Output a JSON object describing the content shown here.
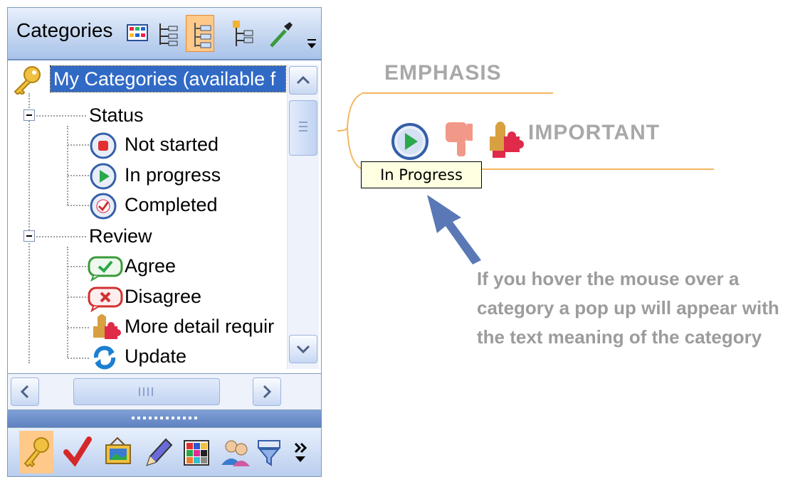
{
  "panel": {
    "title": "Categories",
    "header_buttons": [
      "grid-view-icon",
      "tree-view-icon",
      "tree-detail-icon",
      "tree-add-icon",
      "eyedropper-icon"
    ],
    "tree": {
      "root": "My Categories (available f",
      "groups": [
        {
          "label": "Status",
          "items": [
            {
              "label": "Not started",
              "icon": "not-started-icon"
            },
            {
              "label": "In progress",
              "icon": "in-progress-icon"
            },
            {
              "label": "Completed",
              "icon": "completed-icon"
            }
          ]
        },
        {
          "label": "Review",
          "items": [
            {
              "label": "Agree",
              "icon": "agree-icon"
            },
            {
              "label": "Disagree",
              "icon": "disagree-icon"
            },
            {
              "label": "More detail requir",
              "icon": "puzzle-icon"
            },
            {
              "label": "Update",
              "icon": "update-icon"
            }
          ]
        }
      ]
    },
    "bottom_buttons": [
      "key-icon",
      "check-icon",
      "picture-icon",
      "pen-icon",
      "color-grid-icon",
      "people-icon",
      "filter-icon",
      "more-icon"
    ],
    "colors": {
      "selection": "#316ac5",
      "active_button": "#ffc98a",
      "header": "#c4d6f0"
    }
  },
  "map": {
    "topic_emphasis": "EMPHASIS",
    "topic_important": "IMPORTANT",
    "tooltip": "In Progress",
    "explanation": "If you hover the mouse over a category a pop up will appear with the text meaning of the category",
    "colors": {
      "branch": "#f3b760",
      "topic_text": "#a8a8a8",
      "arrow": "#5a78b5"
    }
  }
}
